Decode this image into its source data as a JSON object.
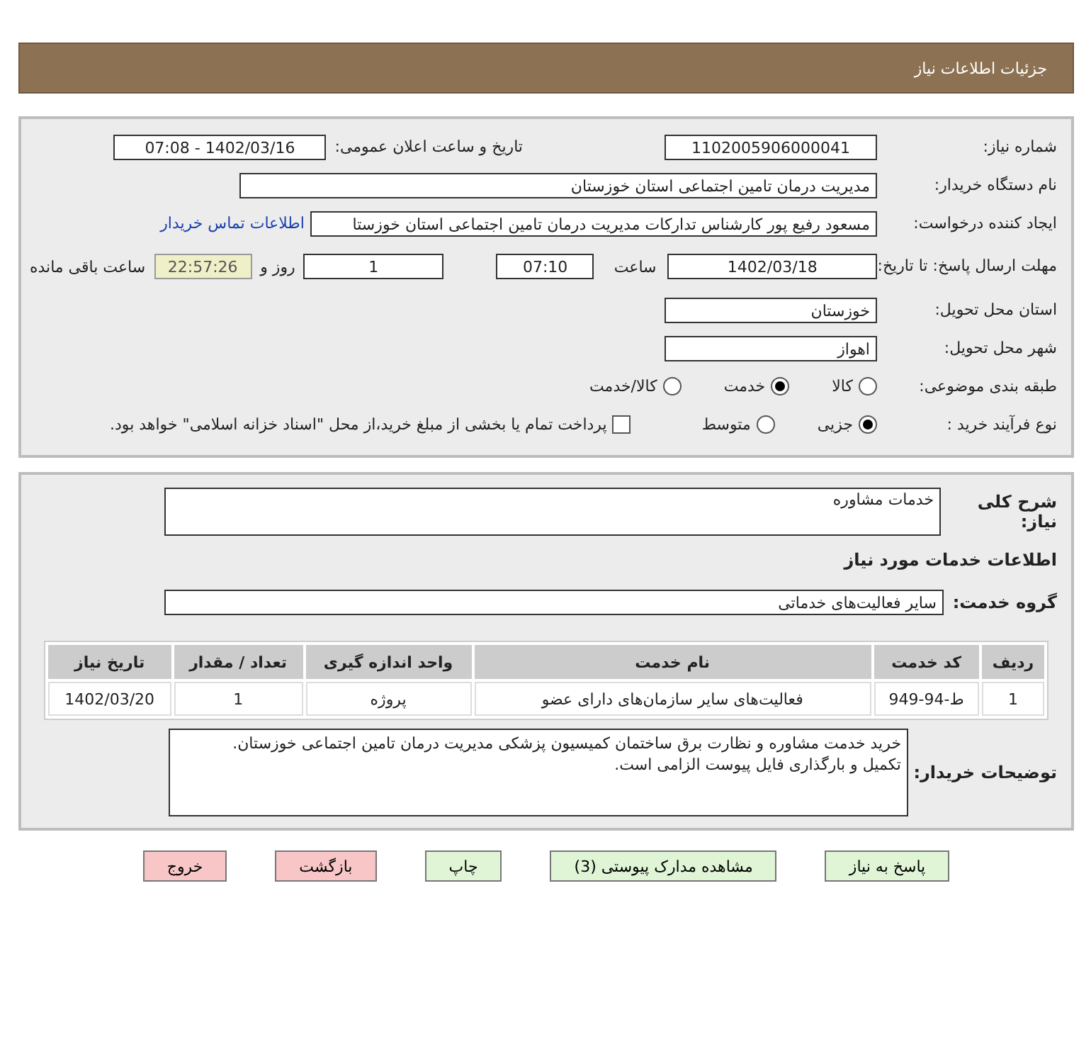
{
  "header": {
    "title": "جزئیات اطلاعات نیاز"
  },
  "need_number": {
    "label": "شماره نیاز:",
    "value": "1102005906000041"
  },
  "announce": {
    "label": "تاریخ و ساعت اعلان عمومی:",
    "value": "1402/03/16 - 07:08"
  },
  "buyer_org": {
    "label": "نام دستگاه خریدار:",
    "value": "مدیریت درمان تامین اجتماعی استان خوزستان"
  },
  "requester": {
    "label": "ایجاد کننده درخواست:",
    "value": "مسعود رفیع پور کارشناس تدارکات مدیریت درمان تامین اجتماعی استان خوزستا",
    "link": "اطلاعات تماس خریدار"
  },
  "deadline": {
    "label": "مهلت ارسال پاسخ: تا تاریخ:",
    "date": "1402/03/18",
    "time_label": "ساعت",
    "time": "07:10",
    "days": "1",
    "days_label": "روز و",
    "remaining": "22:57:26",
    "remaining_label": "ساعت باقی مانده"
  },
  "province": {
    "label": "استان محل تحویل:",
    "value": "خوزستان"
  },
  "city": {
    "label": "شهر محل تحویل:",
    "value": "اهواز"
  },
  "category": {
    "label": "طبقه بندی موضوعی:",
    "options": [
      {
        "label": "کالا",
        "selected": false
      },
      {
        "label": "خدمت",
        "selected": true
      },
      {
        "label": "کالا/خدمت",
        "selected": false
      }
    ]
  },
  "purchase_type": {
    "label": "نوع فرآیند خرید :",
    "options": [
      {
        "label": "جزیی",
        "selected": true
      },
      {
        "label": "متوسط",
        "selected": false
      }
    ],
    "payment": {
      "label": "پرداخت تمام یا بخشی از مبلغ خرید،از محل \"اسناد خزانه اسلامی\" خواهد بود.",
      "checked": false
    }
  },
  "description": {
    "label": "شرح کلی نیاز:",
    "value": "خدمات مشاوره"
  },
  "services_heading": "اطلاعات خدمات مورد نیاز",
  "service_group": {
    "label": "گروه خدمت:",
    "value": "سایر فعالیت‌های خدماتی"
  },
  "table": {
    "columns": [
      "ردیف",
      "کد خدمت",
      "نام خدمت",
      "واحد اندازه گیری",
      "تعداد / مقدار",
      "تاریخ نیاز"
    ],
    "rows": [
      [
        "1",
        "ط-94-949",
        "فعالیت‌های سایر سازمان‌های دارای عضو",
        "پروژه",
        "1",
        "1402/03/20"
      ]
    ]
  },
  "buyer_notes": {
    "label": "توضیحات خریدار:",
    "lines": [
      "خرید خدمت مشاوره و نظارت برق ساختمان کمیسیون پزشکی مدیریت درمان تامین اجتماعی خوزستان.",
      "تکمیل و بارگذاری فایل پیوست الزامی است."
    ]
  },
  "buttons": [
    {
      "label": "پاسخ به نیاز",
      "kind": "normal"
    },
    {
      "label": "مشاهده مدارک پیوستی (3)",
      "kind": "normal"
    },
    {
      "label": "چاپ",
      "kind": "normal"
    },
    {
      "label": "بازگشت",
      "kind": "danger"
    },
    {
      "label": "خروج",
      "kind": "danger"
    }
  ]
}
